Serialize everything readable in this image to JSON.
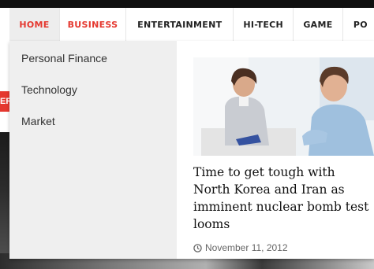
{
  "nav": {
    "items": [
      {
        "label": "HOME"
      },
      {
        "label": "BUSINESS"
      },
      {
        "label": "ENTERTAINMENT"
      },
      {
        "label": "HI-TECH"
      },
      {
        "label": "GAME"
      },
      {
        "label": "PO"
      }
    ],
    "active_color": "#e5382f"
  },
  "dropdown": {
    "items": [
      {
        "label": "Personal Finance"
      },
      {
        "label": "Technology"
      },
      {
        "label": "Market"
      }
    ],
    "featured": {
      "title": "Time to get tough with North Korea and Iran as imminent nuclear bomb test looms",
      "date": "November 11, 2012",
      "date_icon": "clock-icon"
    }
  },
  "background": {
    "badge_text": "ER"
  }
}
